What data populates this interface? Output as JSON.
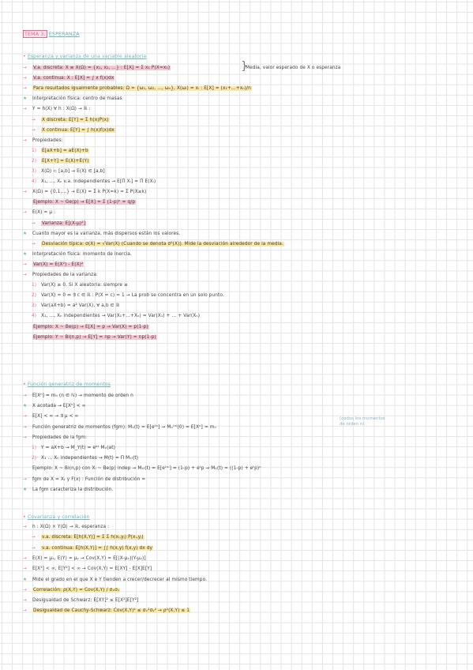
{
  "header": {
    "tag": "TEMA 3.",
    "title": "ESPERANZA"
  },
  "sections": [
    {
      "heading": "Esperanza y varianza de una variable aleatoria",
      "lines": [
        {
          "marker": "→",
          "text": "V.a. discreta: X ≡ X(Ω) = {x₁, x₂, ...} : E[X] = Σ x₁ P(X=x₁)",
          "hl": "pink"
        },
        {
          "marker": "→",
          "text": "V.a. continua: X : E[X] = ∫ x f(x)dx",
          "hl": "pink"
        },
        {
          "marker": "→",
          "text": "Para resultados igualmente probables: Ω = {ω₁, ω₂, ..., ωₙ}, X(ωᵢ) = xᵢ : E[X] = (x₁+...+xₙ)/n",
          "hl": "yellow"
        },
        {
          "marker": "★",
          "text": "Interpretación física: centro de masas",
          "hl": "none"
        },
        {
          "marker": "→",
          "text": "Y = h(X) ∀ h : X(Ω) → ℝ :",
          "hl": "none"
        },
        {
          "marker": "→",
          "text": "X discreta: E[Y] = Σ h(x)P(x)",
          "hl": "yellow"
        },
        {
          "marker": "→",
          "text": "X continua: E[Y] = ∫ h(x)f(x)dx",
          "hl": "yellow"
        },
        {
          "marker": "→",
          "text": "Propiedades:",
          "hl": "none"
        },
        {
          "marker": "1)",
          "text": "E[aX+b] = aE(X)+b",
          "hl": "yellow"
        },
        {
          "marker": "2)",
          "text": "E[X+Y] = E(X)+E(Y)",
          "hl": "yellow"
        },
        {
          "marker": "3)",
          "text": "X(Ω) ⊂ [a,b] → E(X) ∈ [a,b]",
          "hl": "none"
        },
        {
          "marker": "4)",
          "text": "X₁, ..., Xₙ v.a. independientes → E[Π Xᵢ] = Π E(Xᵢ)",
          "hl": "none"
        },
        {
          "marker": "→",
          "text": "X(Ω) = {0,1,...} → E(X) = Σ k P(X=k) = Σ P(X≥k)",
          "hl": "none"
        },
        {
          "marker": "",
          "text": "Ejemplo: X ~ Ge(p) → E[X] = Σ (1-p)ᵏ = q/p",
          "hl": "pink"
        },
        {
          "marker": "→",
          "text": "E(X) = μ :",
          "hl": "none"
        },
        {
          "marker": "→",
          "text": "Varianza: E[(X-μ)²]",
          "hl": "pink"
        },
        {
          "marker": "★",
          "text": "Cuanto mayor es la varianza, más dispersos están los valores.",
          "hl": "none"
        },
        {
          "marker": "→",
          "text": "Desviación típica: σ(X) = √Var(X) (Cuando se denota σ²(X)). Mide la desviación alrededor de la media.",
          "hl": "yellow"
        },
        {
          "marker": "★",
          "text": "Interpretación física: momento de inercia.",
          "hl": "none"
        },
        {
          "marker": "→",
          "text": "Var(X) = E(X²) - E(X)²",
          "hl": "pink"
        },
        {
          "marker": "→",
          "text": "Propiedades de la varianza:",
          "hl": "none"
        },
        {
          "marker": "1)",
          "text": "Var(X) ≥ 0. Si X aleatoria: siempre ≥",
          "hl": "none"
        },
        {
          "marker": "2)",
          "text": "Var(X) = 0 ⇔ ∃ c ∈ ℝ : P(X = c) = 1 → La prob se concentra en un solo punto.",
          "hl": "none"
        },
        {
          "marker": "3)",
          "text": "Var(aX+b) = a² Var(X), ∀ a,b ∈ ℝ",
          "hl": "none"
        },
        {
          "marker": "4)",
          "text": "X₁, ..., Xₙ independientes → Var(X₁+...+Xₙ) = Var(X₁) + ... + Var(Xₙ)",
          "hl": "none"
        },
        {
          "marker": "",
          "text": "Ejemplo: X ~ Be(p) → E[X] = p → Var(X) = p(1-p)",
          "hl": "pink"
        },
        {
          "marker": "",
          "text": "Ejemplo: Y ~ Bi(n,p) → E[Y] = np → Var(Y) = np(1-p)",
          "hl": "pink"
        }
      ]
    },
    {
      "heading": "Función generatriz de momentos",
      "lines": [
        {
          "marker": "→",
          "text": "E[Xⁿ] = mₙ (n ∈ ℕ) → momento de orden n",
          "hl": "none"
        },
        {
          "marker": "★",
          "text": "X acotada → E[Xⁿ] < ∞",
          "hl": "none"
        },
        {
          "marker": "→",
          "text": "E[X] < ∞ → ∃ μ < ∞",
          "hl": "none"
        },
        {
          "marker": "→",
          "text": "Función generatriz de momentos (fgm): Mₓ(t) = E[eᵗˣ] → Mₓ⁽ⁿ⁾(0) = E[Xⁿ] = mₙ",
          "hl": "none"
        },
        {
          "marker": "→",
          "text": "Propiedades de la fgm:",
          "hl": "none"
        },
        {
          "marker": "1)",
          "text": "Y = aX+b → M_Y(t) = eᵇᵗ Mₓ(at)",
          "hl": "none"
        },
        {
          "marker": "2)",
          "text": "X₁ ... Xₙ independientes → M(t) = Π Mₓᵢ(t)",
          "hl": "none"
        },
        {
          "marker": "",
          "text": "Ejemplo: X ~ Bi(n,p) con Xᵢ ~ Be(p) indep → Mₓᵢ(t) = E[eᵗˣⁱ] = (1-p) + eᵗp → Mₓ(t) = ((1-p) + eᵗp)ⁿ",
          "hl": "none"
        },
        {
          "marker": "→",
          "text": "fgm de X = Xₜ y F(x) : Función de distribución =",
          "hl": "none"
        },
        {
          "marker": "★",
          "text": "La fgm caracteriza la distribución.",
          "hl": "none"
        }
      ],
      "side_note": [
        "(codos los momentos",
        "de orden n)"
      ]
    },
    {
      "heading": "Covarianza y correlación",
      "lines": [
        {
          "marker": "→",
          "text": "h : X(Ω) × Y(Ω) → ℝ, esperanza :",
          "hl": "none"
        },
        {
          "marker": "→",
          "text": "v.a. discreta: E[h(X,Y)] = Σ Σ h(xᵢ,yⱼ) P(xᵢ,yⱼ)",
          "hl": "yellow"
        },
        {
          "marker": "→",
          "text": "v.a. continua: E[h(X,Y)] = ∫∫ h(x,y) f(x,y) dx dy",
          "hl": "yellow"
        },
        {
          "marker": "→",
          "text": "E(X) = μₓ, E(Y) = μᵧ → Cov(X,Y) = E[(X-μₓ)(Y-μᵧ)]",
          "hl": "none"
        },
        {
          "marker": "→",
          "text": "E[X²] < ∞, E[Y²] < ∞ → Cov(X,Y) = E[XY] - E[X]E[Y]",
          "hl": "none"
        },
        {
          "marker": "★",
          "text": "Mide el grado en el que X e Y tienden a crecer/decrecer al mismo tiempo.",
          "hl": "none"
        },
        {
          "marker": "→",
          "text": "Correlación: ρ(X,Y) = Cov(X,Y) / σₓσᵧ",
          "hl": "yellow"
        },
        {
          "marker": "→",
          "text": "Desigualdad de Schwarz: E[XY]² ≤ E[X²]E[Y²]",
          "hl": "none"
        },
        {
          "marker": "→",
          "text": "Desigualdad de Cauchy-Schwarz: Cov(X,Y)² ≤ σₓ²σᵧ² → ρ²(X,Y) ≤ 1",
          "hl": "yellow"
        }
      ]
    }
  ],
  "annotations": {
    "expectation_note": "Media, valor esperado de X o esperanza"
  }
}
